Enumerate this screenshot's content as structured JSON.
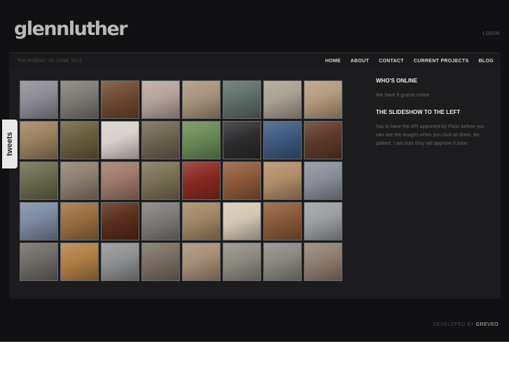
{
  "header": {
    "logo": "glennluther",
    "login": "LOGIN"
  },
  "navbar": {
    "date": "THURSDAY, 16 JUNE 2011",
    "items": [
      "HOME",
      "ABOUT",
      "CONTACT",
      "CURRENT PROJECTS",
      "BLOG"
    ]
  },
  "sidebar": {
    "online_title": "WHO'S ONLINE",
    "online_text": "We have 5 guests online",
    "slideshow_title": "THE SLIDESHOW TO THE LEFT",
    "slideshow_text": "has to have the API approved by Flickr before you can see the images when you click on them. Be patient, I am sure they will approve it soon."
  },
  "tweets_tab": "tweets",
  "footer": {
    "developed_by": "DEVELOPED BY",
    "developer": "GREVEO"
  },
  "gallery": {
    "colors": [
      [
        "#8c8c94",
        "#7e7a74",
        "#6e4a32",
        "#b6a49c",
        "#a6947a",
        "#5e6e6a",
        "#a8a092",
        "#b29a7e"
      ],
      [
        "#9a8260",
        "#6a5e3e",
        "#d8d0cc",
        "#6e6452",
        "#6a8a58",
        "#2e2e30",
        "#3e5a7e",
        "#5e3a2a"
      ],
      [
        "#6a6a4e",
        "#8e7e6e",
        "#9e7a6a",
        "#7a7054",
        "#8a2a22",
        "#8e5a3a",
        "#b08e68",
        "#8a8e9a"
      ],
      [
        "#7a8a9e",
        "#9a6e40",
        "#5a2e1e",
        "#7e7a7a",
        "#a08664",
        "#d4c8b4",
        "#8a5a3a",
        "#9a9ea0"
      ],
      [
        "#6e6a66",
        "#b07e44",
        "#8e9092",
        "#7a6e62",
        "#a48e76",
        "#8e8a82",
        "#8a8880",
        "#8e7e70"
      ]
    ]
  }
}
